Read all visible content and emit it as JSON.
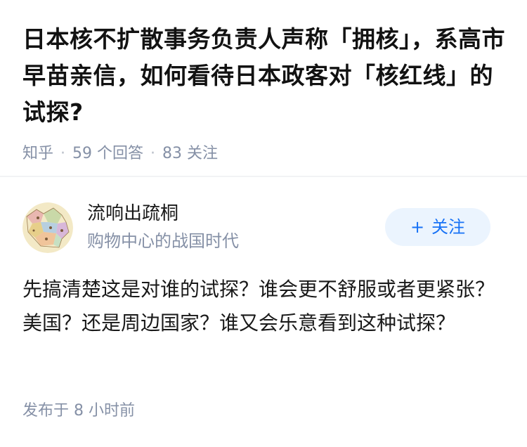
{
  "question": {
    "title": "日本核不扩散事务负责人声称「拥核」，系高市早苗亲信，如何看待日本政客对「核红线」的试探?",
    "source": "知乎",
    "answer_count": "59 个回答",
    "follower_count": "83 关注"
  },
  "answer": {
    "author_name": "流响出疏桐",
    "author_bio": "购物中心的战国时代",
    "follow_label": "关注",
    "follow_icon": "plus-icon",
    "body": "先搞清楚这是对谁的试探？谁会更不舒服或者更紧张？美国？还是周边国家？谁又会乐意看到这种试探？",
    "published": "发布于 8 小时前"
  },
  "colors": {
    "accent": "#1772f6",
    "accent_bg": "#ebf4fe",
    "meta": "#8590a6",
    "text": "#191919"
  }
}
